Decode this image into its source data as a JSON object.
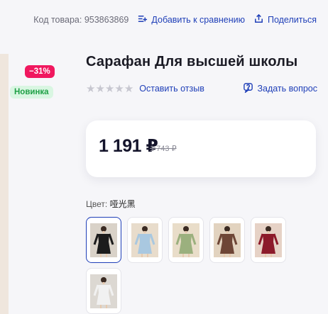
{
  "header": {
    "sku": "Код товара: 953863869",
    "compare_label": "Добавить к сравнению",
    "share_label": "Поделиться"
  },
  "badges": {
    "discount": "−31%",
    "new": "Новинка"
  },
  "product": {
    "title": "Сарафан Для высшей школы",
    "rating_stars": 0,
    "review_link": "Оставить отзыв",
    "ask_link": "Задать вопрос"
  },
  "price": {
    "current": "1 191 ₽",
    "old": "1 743 ₽"
  },
  "colors": {
    "label": "Цвет:",
    "selected": "哑光黑",
    "swatches": [
      {
        "name": "black",
        "dress": "#1c1c1c",
        "bg": "#d9d2c8"
      },
      {
        "name": "light-blue",
        "dress": "#a9c8e0",
        "bg": "#e8dccb"
      },
      {
        "name": "sage-green",
        "dress": "#9bb07e",
        "bg": "#e9ddc9"
      },
      {
        "name": "brown",
        "dress": "#6e4636",
        "bg": "#e2d3bf"
      },
      {
        "name": "burgundy",
        "dress": "#8c1a2a",
        "bg": "#e6d2c6"
      },
      {
        "name": "white",
        "dress": "#f1f1f1",
        "bg": "#dcd8d2"
      }
    ]
  },
  "theme": {
    "accent": "#1f3fb8",
    "discount": "#f0185f",
    "new_bg": "#d9f6e2",
    "new_fg": "#1fa046"
  }
}
